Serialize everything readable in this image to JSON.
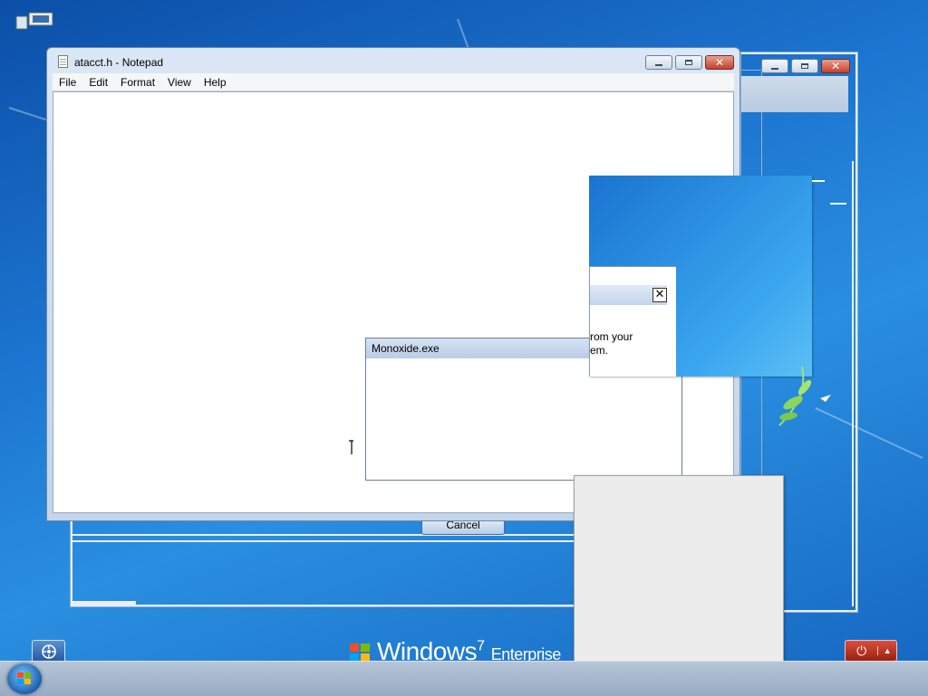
{
  "notepad": {
    "title": "atacct.h - Notepad",
    "menu": [
      "File",
      "Edit",
      "Format",
      "View",
      "Help"
    ]
  },
  "monoxide": {
    "title": "Monoxide.exe"
  },
  "partial_dialog": {
    "text_line1": "rom your",
    "text_line2": "em."
  },
  "background_dialog": {
    "cancel_label": "Cancel"
  },
  "branding": {
    "windows": "Windows",
    "version": "7",
    "edition": "Enterprise"
  },
  "icons": {
    "close": "close-icon",
    "minimize": "minimize-icon",
    "maximize": "maximize-icon",
    "power": "power-icon",
    "accessibility": "ease-of-access-icon",
    "start": "windows-start-icon"
  }
}
